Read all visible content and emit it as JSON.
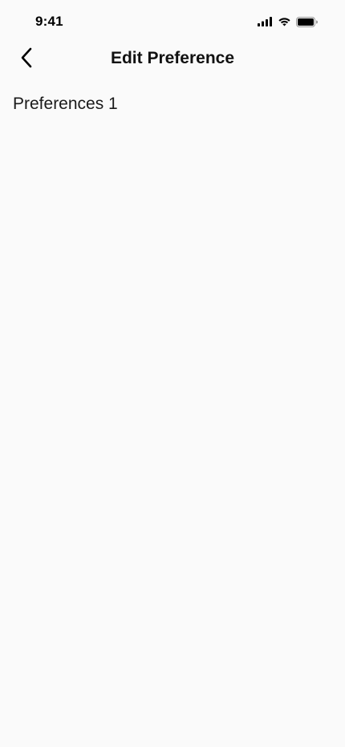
{
  "status_bar": {
    "time": "9:41",
    "icons": [
      "cellular-signal-icon",
      "wifi-icon",
      "battery-icon"
    ]
  },
  "header": {
    "back_icon": "chevron-left-icon",
    "title": "Edit Preference"
  },
  "main": {
    "section_label": "Preferences 1"
  },
  "colors": {
    "background": "#fafafa",
    "text": "#111111"
  }
}
